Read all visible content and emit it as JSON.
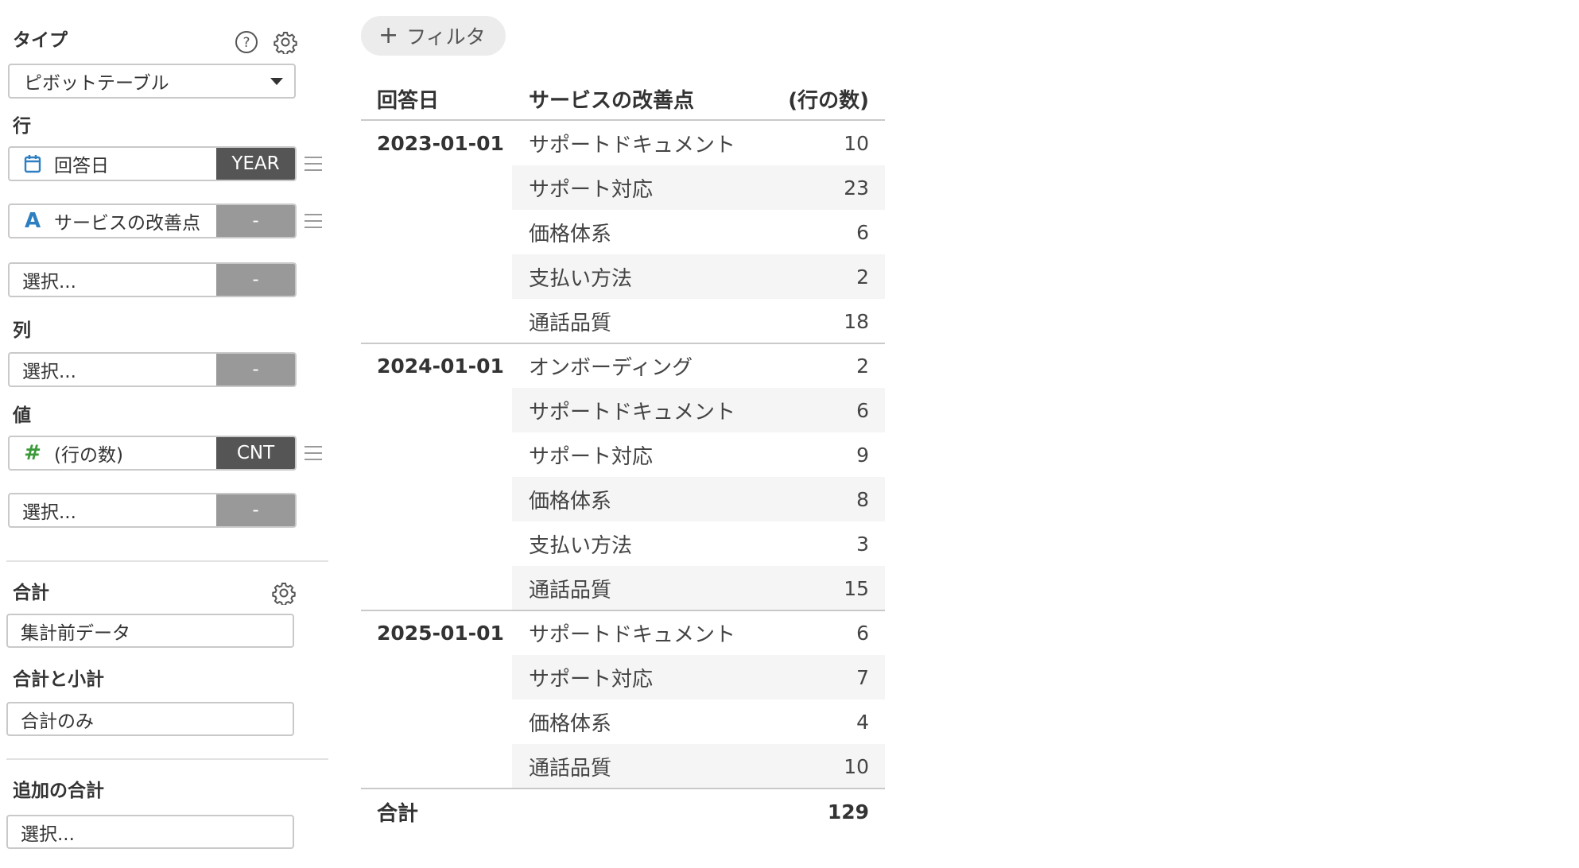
{
  "panel": {
    "type_label": "タイプ",
    "help_icon": "question-circle-icon",
    "settings_icon": "gear-icon",
    "type_value": "ピボットテーブル",
    "rows_label": "行",
    "row_fields": [
      {
        "icon": "calendar-icon",
        "name": "回答日",
        "agg": "YEAR"
      },
      {
        "icon": "text-type-icon",
        "icon_glyph": "A",
        "name": "サービスの改善点",
        "agg": "-"
      },
      {
        "name": "選択...",
        "agg": "-"
      }
    ],
    "columns_label": "列",
    "column_fields": [
      {
        "name": "選択...",
        "agg": "-"
      }
    ],
    "values_label": "値",
    "value_fields": [
      {
        "icon": "number-type-icon",
        "icon_glyph": "#",
        "name": "(行の数)",
        "agg": "CNT"
      },
      {
        "name": "選択...",
        "agg": "-"
      }
    ],
    "total_label": "合計",
    "total_value": "集計前データ",
    "subtotal_label": "合計と小計",
    "subtotal_value": "合計のみ",
    "extra_total_label": "追加の合計",
    "extra_total_value": "選択..."
  },
  "filter_button": {
    "plus": "+",
    "label": "フィルタ"
  },
  "table": {
    "headers": {
      "date": "回答日",
      "category": "サービスの改善点",
      "count": "(行の数)"
    },
    "groups": [
      {
        "date": "2023-01-01",
        "rows": [
          {
            "category": "サポートドキュメント",
            "count": "10"
          },
          {
            "category": "サポート対応",
            "count": "23"
          },
          {
            "category": "価格体系",
            "count": "6"
          },
          {
            "category": "支払い方法",
            "count": "2"
          },
          {
            "category": "通話品質",
            "count": "18"
          }
        ]
      },
      {
        "date": "2024-01-01",
        "rows": [
          {
            "category": "オンボーディング",
            "count": "2"
          },
          {
            "category": "サポートドキュメント",
            "count": "6"
          },
          {
            "category": "サポート対応",
            "count": "9"
          },
          {
            "category": "価格体系",
            "count": "8"
          },
          {
            "category": "支払い方法",
            "count": "3"
          },
          {
            "category": "通話品質",
            "count": "15"
          }
        ]
      },
      {
        "date": "2025-01-01",
        "rows": [
          {
            "category": "サポートドキュメント",
            "count": "6"
          },
          {
            "category": "サポート対応",
            "count": "7"
          },
          {
            "category": "価格体系",
            "count": "4"
          },
          {
            "category": "通話品質",
            "count": "10"
          }
        ]
      }
    ],
    "total_label": "合計",
    "total_value": "129"
  },
  "colors": {
    "calendar_icon": "#2d7fc1",
    "text_icon": "#2d7fc1",
    "number_icon": "#3a9a3a",
    "agg_dark": "#555555",
    "agg_light": "#999999",
    "alt_row": "#f5f5f5"
  }
}
